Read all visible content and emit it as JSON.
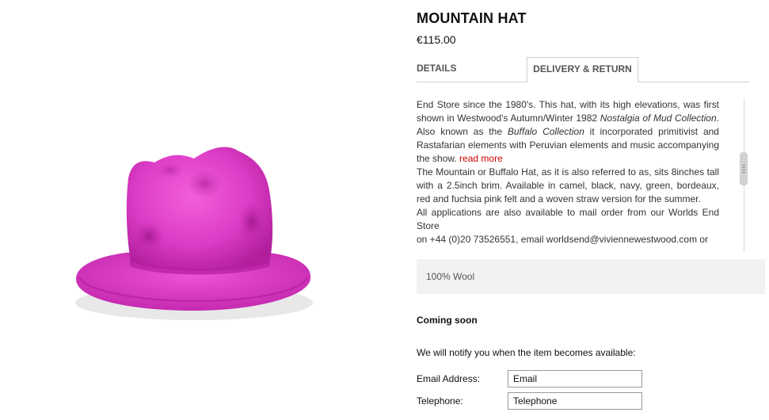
{
  "product": {
    "title": "MOUNTAIN HAT",
    "price": "€115.00",
    "image_color": "#e84fd0"
  },
  "tabs": [
    {
      "label": "DETAILS",
      "active": true
    },
    {
      "label": "DELIVERY & RETURN",
      "active": false
    }
  ],
  "description": {
    "p1_a": "End Store since the 1980's. This hat, with its high elevations, was first shown in Westwood's Autumn/Winter 1982 ",
    "p1_em1": "Nostalgia of Mud Collection",
    "p1_b": ". Also known as the ",
    "p1_em2": "Buffalo Collection",
    "p1_c": " it incorporated primitivist and Rastafarian elements with Peruvian elements and music accompanying the show. ",
    "read_more": "read more",
    "p2": "The Mountain or Buffalo Hat, as it is also referred to as, sits 8inches tall with a 2.5inch brim. Available in camel, black, navy, green, bordeaux, red and fuchsia pink felt and a woven straw version for the summer.",
    "p3": "All applications are also available to mail order from our Worlds End Store",
    "p4": "on +44 (0)20 73526551, email worldsend@viviennewestwood.com or"
  },
  "material": "100% Wool",
  "availability": {
    "status": "Coming soon",
    "notify_text": "We will notify you when the item becomes available:"
  },
  "form": {
    "email_label": "Email Address:",
    "email_placeholder": "Email",
    "phone_label": "Telephone:",
    "phone_placeholder": "Telephone"
  }
}
